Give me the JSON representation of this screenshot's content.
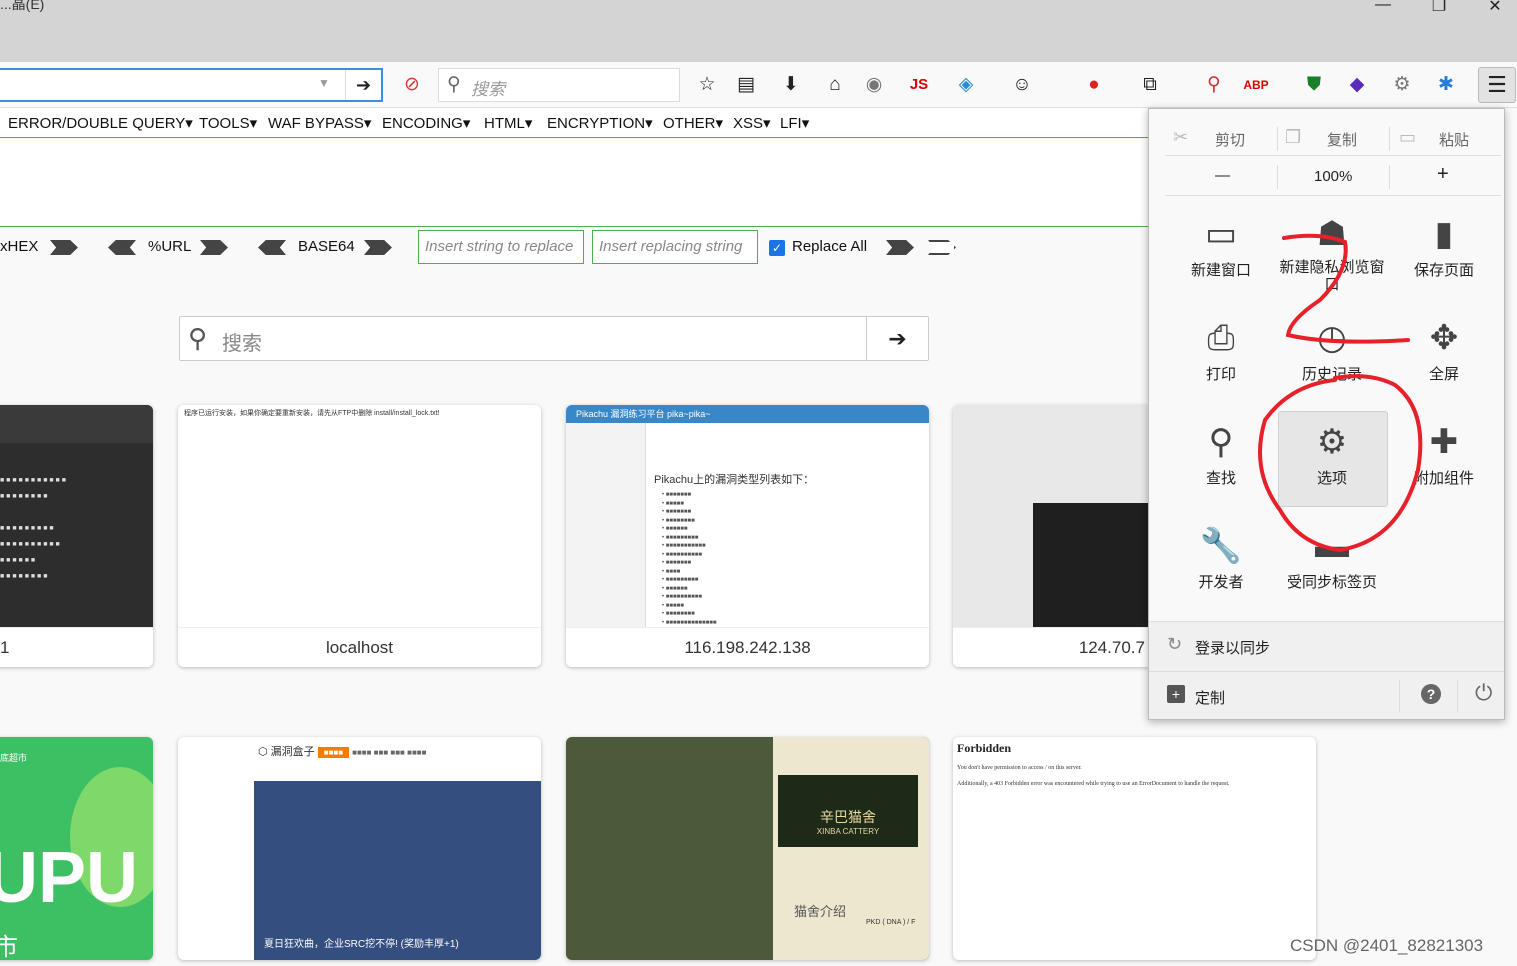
{
  "window": {
    "title": "...晶(E)",
    "min": "—",
    "restore": "❐",
    "close": "✕"
  },
  "nav": {
    "go": "➔",
    "dropdown": "▼",
    "search_placeholder": "搜索",
    "search_icon": "⚲",
    "menu_icon": "☰"
  },
  "hackbar_menu": [
    "ERROR/DOUBLE QUERY",
    "TOOLS",
    "WAF BYPASS",
    "ENCODING",
    "HTML",
    "ENCRYPTION",
    "OTHER",
    "XSS",
    "LFI"
  ],
  "hackbar_bottom": {
    "hex": "xHEX",
    "url": "%URL",
    "base64": "BASE64",
    "replace_ph": "Insert string to replace",
    "replacing_ph": "Insert replacing string",
    "replace_all": "Replace All",
    "check": "✓"
  },
  "page_search": {
    "placeholder": "搜索",
    "icon": "⚲",
    "go": "➔"
  },
  "tiles": {
    "t1": {
      "label": "1"
    },
    "t2": {
      "label": "localhost",
      "note": "程序已运行安装，如果你确定要重新安装，请先从FTP中删除 install/install_lock.txt!"
    },
    "t3": {
      "label": "116.198.242.138",
      "header": "Pikachu 漏洞练习平台 pika~pika~",
      "heading": "Pikachu上的漏洞类型列表如下："
    },
    "t4": {
      "label": "124.70.7"
    },
    "t5": {
      "big": "UPU",
      "small": "市",
      "corner": "底超市"
    },
    "t6": {
      "brand": "漏洞盒子",
      "banner": "夏日狂欢曲，企业SRC挖不停! (奖励丰厚+1)"
    },
    "t7": {
      "title": "辛巴猫舍",
      "sub": "XINBA CATTERY",
      "intro": "猫舍介绍",
      "dna": "PKD ( DNA ) / F"
    },
    "t8": {
      "title": "Forbidden",
      "line1": "You don't have permission to access / on this server.",
      "line2": "Additionally, a 403 Forbidden error was encountered while trying to use an ErrorDocument to handle the request."
    }
  },
  "panel": {
    "cut": "剪切",
    "copy": "复制",
    "paste": "粘贴",
    "zoom_out": "—",
    "zoom": "100%",
    "zoom_in": "+",
    "items": [
      "新建窗口",
      "新建隐私浏览窗口",
      "保存页面",
      "打印",
      "历史记录",
      "全屏",
      "查找",
      "选项",
      "附加组件",
      "开发者",
      "受同步标签页"
    ],
    "sync": "登录以同步",
    "customize": "定制",
    "help": "?",
    "quit": "⏻"
  },
  "watermark": "CSDN @2401_82821303"
}
